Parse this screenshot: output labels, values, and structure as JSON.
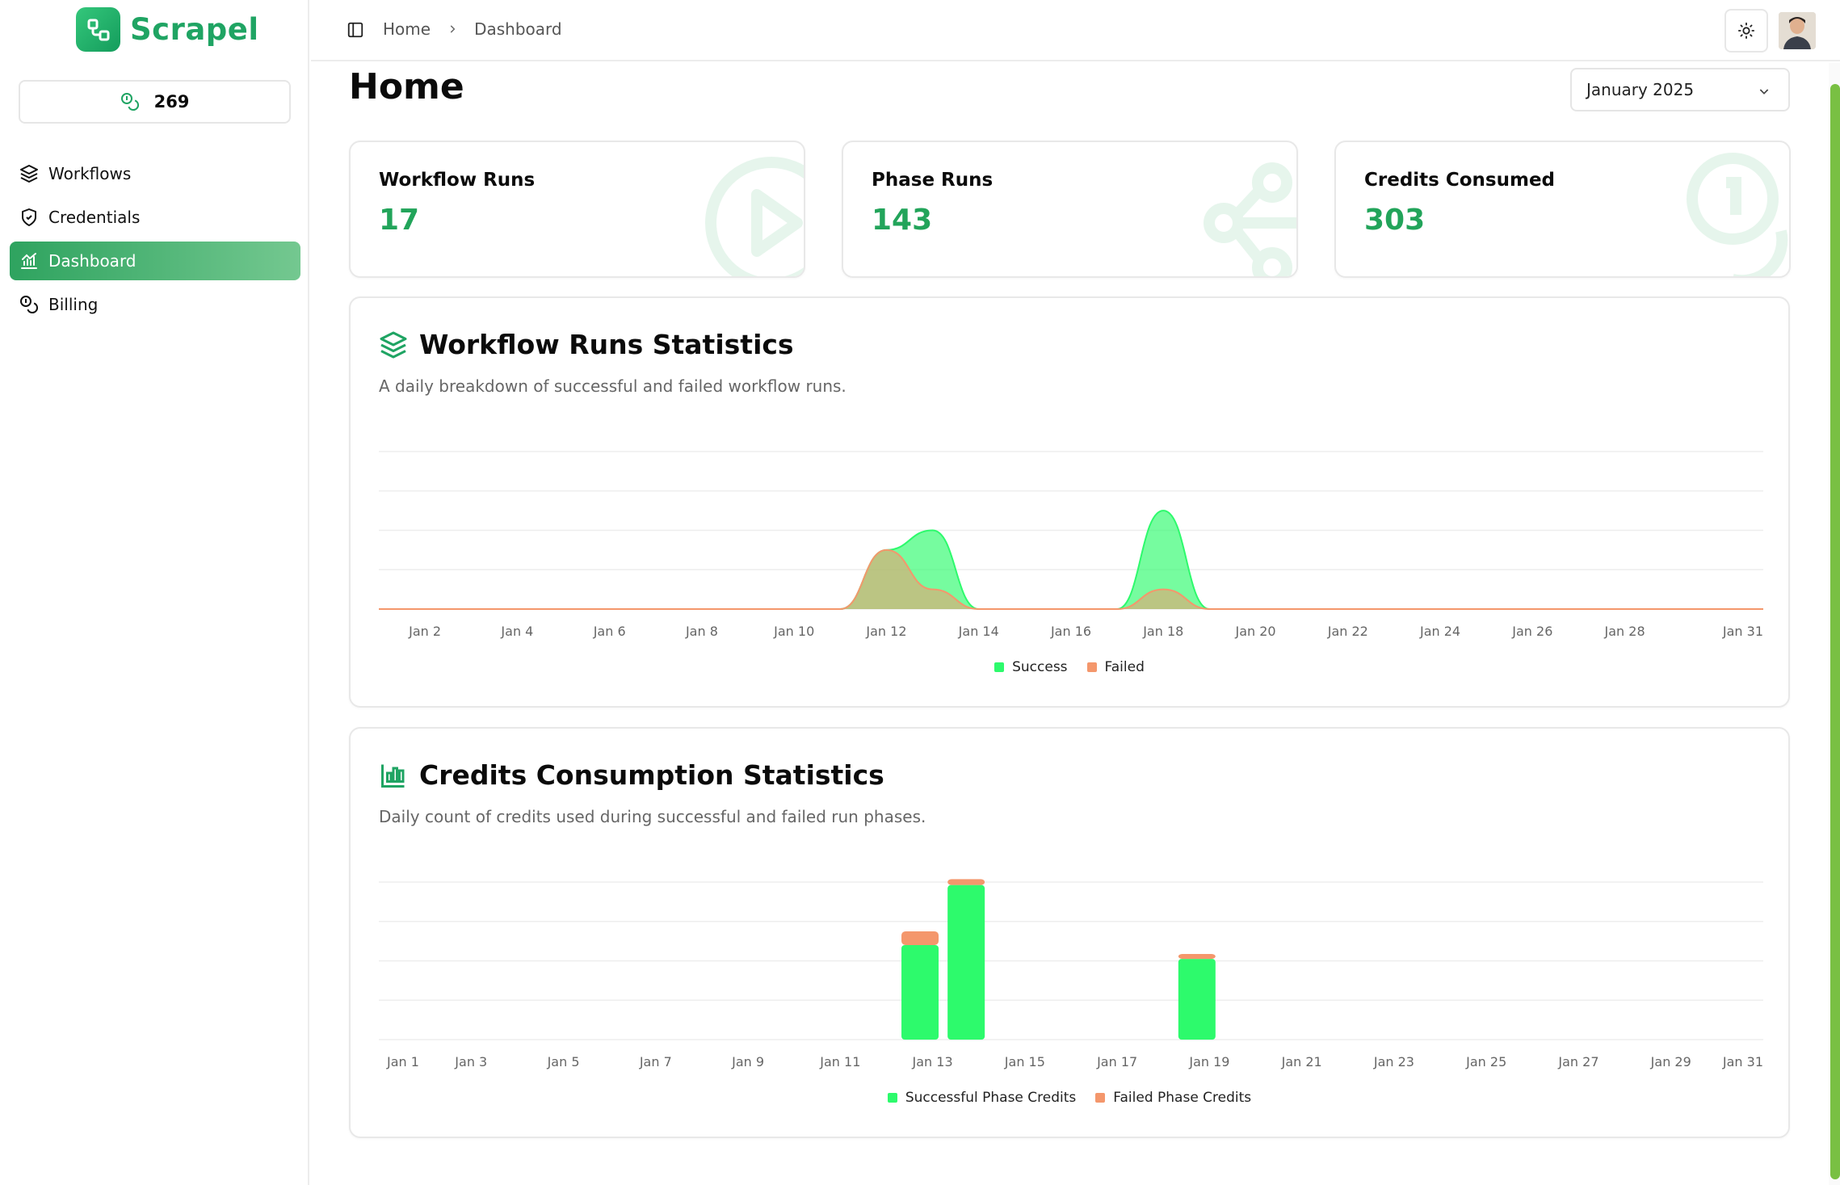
{
  "app": {
    "name": "Scrapel"
  },
  "sidebar": {
    "credits": "269",
    "items": [
      {
        "label": "Workflows",
        "icon": "layers-icon",
        "active": false
      },
      {
        "label": "Credentials",
        "icon": "shield-icon",
        "active": false
      },
      {
        "label": "Dashboard",
        "icon": "chart-icon",
        "active": true
      },
      {
        "label": "Billing",
        "icon": "coins-icon",
        "active": false
      }
    ]
  },
  "topbar": {
    "breadcrumb": [
      "Home",
      "Dashboard"
    ]
  },
  "page": {
    "title": "Home",
    "period": "January 2025"
  },
  "stats": [
    {
      "label": "Workflow Runs",
      "value": "17",
      "icon": "play-circle-icon"
    },
    {
      "label": "Phase Runs",
      "value": "143",
      "icon": "share-nodes-icon"
    },
    {
      "label": "Credits Consumed",
      "value": "303",
      "icon": "coins-icon"
    }
  ],
  "colors": {
    "brand": "#1fa463",
    "success": "#2dfa6c",
    "failed": "#f4976c",
    "accent_green": "#22a45a"
  },
  "chart_data": [
    {
      "type": "area",
      "title": "Workflow Runs Statistics",
      "subtitle": "A daily breakdown of successful and failed workflow runs.",
      "x": [
        "Jan 1",
        "Jan 2",
        "Jan 3",
        "Jan 4",
        "Jan 5",
        "Jan 6",
        "Jan 7",
        "Jan 8",
        "Jan 9",
        "Jan 10",
        "Jan 11",
        "Jan 12",
        "Jan 13",
        "Jan 14",
        "Jan 15",
        "Jan 16",
        "Jan 17",
        "Jan 18",
        "Jan 19",
        "Jan 20",
        "Jan 21",
        "Jan 22",
        "Jan 23",
        "Jan 24",
        "Jan 25",
        "Jan 26",
        "Jan 27",
        "Jan 28",
        "Jan 29",
        "Jan 30",
        "Jan 31"
      ],
      "tick_labels": [
        "Jan 2",
        "Jan 4",
        "Jan 6",
        "Jan 8",
        "Jan 10",
        "Jan 12",
        "Jan 14",
        "Jan 16",
        "Jan 18",
        "Jan 20",
        "Jan 22",
        "Jan 24",
        "Jan 26",
        "Jan 28",
        "Jan 31"
      ],
      "series": [
        {
          "name": "Success",
          "color": "#2dfa6c",
          "values": [
            0,
            0,
            0,
            0,
            0,
            0,
            0,
            0,
            0,
            0,
            0,
            3,
            4,
            0,
            0,
            0,
            0,
            5,
            0,
            0,
            0,
            0,
            0,
            0,
            0,
            0,
            0,
            0,
            0,
            0,
            0
          ]
        },
        {
          "name": "Failed",
          "color": "#f4976c",
          "values": [
            0,
            0,
            0,
            0,
            0,
            0,
            0,
            0,
            0,
            0,
            0,
            3,
            1,
            0,
            0,
            0,
            0,
            1,
            0,
            0,
            0,
            0,
            0,
            0,
            0,
            0,
            0,
            0,
            0,
            0,
            0
          ]
        }
      ],
      "ylim": [
        0,
        8
      ],
      "grid": true,
      "legend": "bottom"
    },
    {
      "type": "bar",
      "stacked": true,
      "title": "Credits Consumption Statistics",
      "subtitle": "Daily count of credits used during successful and failed run phases.",
      "x": [
        "Jan 1",
        "Jan 2",
        "Jan 3",
        "Jan 4",
        "Jan 5",
        "Jan 6",
        "Jan 7",
        "Jan 8",
        "Jan 9",
        "Jan 10",
        "Jan 11",
        "Jan 12",
        "Jan 13",
        "Jan 14",
        "Jan 15",
        "Jan 16",
        "Jan 17",
        "Jan 18",
        "Jan 19",
        "Jan 20",
        "Jan 21",
        "Jan 22",
        "Jan 23",
        "Jan 24",
        "Jan 25",
        "Jan 26",
        "Jan 27",
        "Jan 28",
        "Jan 29",
        "Jan 30",
        "Jan 31"
      ],
      "tick_labels": [
        "Jan 1",
        "Jan 3",
        "Jan 5",
        "Jan 7",
        "Jan 9",
        "Jan 11",
        "Jan 13",
        "Jan 15",
        "Jan 17",
        "Jan 19",
        "Jan 21",
        "Jan 23",
        "Jan 25",
        "Jan 27",
        "Jan 29",
        "Jan 31"
      ],
      "series": [
        {
          "name": "Successful Phase Credits",
          "color": "#2dfa6c",
          "values": [
            0,
            0,
            0,
            0,
            0,
            0,
            0,
            0,
            0,
            0,
            0,
            96,
            157,
            0,
            0,
            0,
            0,
            82,
            0,
            0,
            0,
            0,
            0,
            0,
            0,
            0,
            0,
            0,
            0,
            0,
            0
          ]
        },
        {
          "name": "Failed Phase Credits",
          "color": "#f4976c",
          "values": [
            0,
            0,
            0,
            0,
            0,
            0,
            0,
            0,
            0,
            0,
            0,
            14,
            6,
            0,
            0,
            0,
            0,
            5,
            0,
            0,
            0,
            0,
            0,
            0,
            0,
            0,
            0,
            0,
            0,
            0,
            0
          ]
        }
      ],
      "ylim": [
        0,
        160
      ],
      "grid": true,
      "legend": "bottom"
    }
  ]
}
